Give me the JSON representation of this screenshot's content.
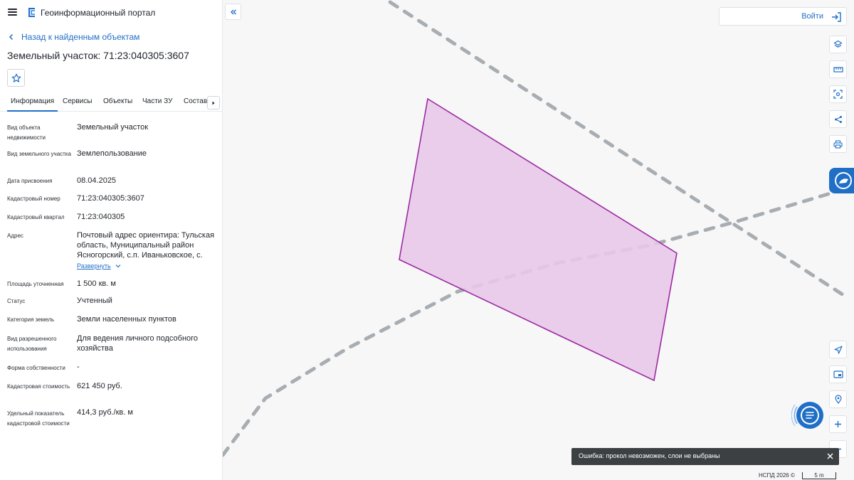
{
  "header": {
    "app_title": "Геоинформационный портал"
  },
  "back_link": "Назад к найденным объектам",
  "object_title": "Земельный участок: 71:23:040305:3607",
  "tabs": [
    {
      "label": "Информация",
      "active": true
    },
    {
      "label": "Сервисы"
    },
    {
      "label": "Объекты"
    },
    {
      "label": "Части ЗУ"
    },
    {
      "label": "Состав"
    }
  ],
  "properties": [
    {
      "label": "Вид объекта недвижимости",
      "value": "Земельный участок"
    },
    {
      "label": "Вид земельного участка",
      "value": "Землепользование"
    },
    {
      "label": "Дата присвоения",
      "value": "08.04.2025"
    },
    {
      "label": "Кадастровый номер",
      "value": "71:23:040305:3607"
    },
    {
      "label": "Кадастровый квартал",
      "value": "71:23:040305"
    },
    {
      "label": "Адрес",
      "value": "Почтовый адрес ориентира: Тульская область, Муниципальный район Ясногорский, с.п. Иваньковское, с."
    },
    {
      "label": "Площадь уточненная",
      "value": "1 500 кв. м"
    },
    {
      "label": "Статус",
      "value": "Учтенный"
    },
    {
      "label": "Категория земель",
      "value": "Земли населенных пунктов"
    },
    {
      "label": "Вид разрешенного использования",
      "value": "Для ведения личного подсобного хозяйства"
    },
    {
      "label": "Форма собственности",
      "value": "-"
    },
    {
      "label": "Кадастровая стоимость",
      "value": "621 450 руб."
    },
    {
      "label": "Удельный показатель кадастровой стоимости",
      "value": "414,3 руб./кв. м"
    }
  ],
  "expand_label": "Развернуть",
  "login": {
    "label": "Войти"
  },
  "toast": {
    "message": "Ошибка: прокол невозможен, слои не выбраны"
  },
  "footer": {
    "copyright": "НСПД 2026 ©",
    "scale": "5 m"
  },
  "colors": {
    "accent": "#1f6fc7",
    "parcel_fill": "#e8c8e8",
    "parcel_stroke": "#9b2aa3"
  }
}
